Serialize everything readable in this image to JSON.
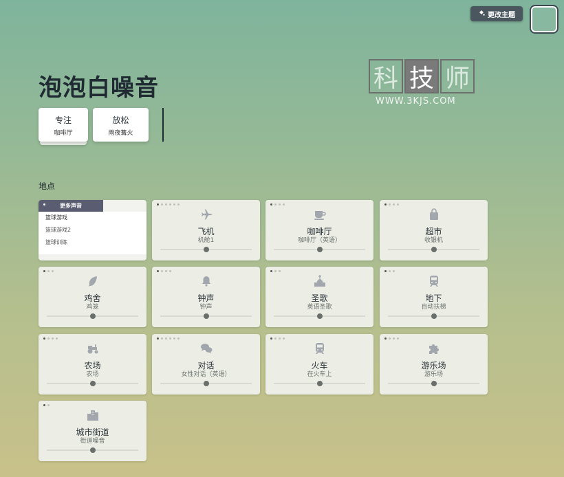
{
  "header": {
    "theme_button_label": "更改主题",
    "app_title": "泡泡白噪音"
  },
  "watermark": {
    "chars": [
      "科",
      "技",
      "师"
    ],
    "url": "WWW.3KJS.COM"
  },
  "modes": [
    {
      "label": "专注",
      "sub": "咖啡厅"
    },
    {
      "label": "放松",
      "sub": "雨夜篝火"
    }
  ],
  "section": {
    "label": "地点"
  },
  "more_sounds": {
    "header": "更多声音",
    "items": [
      "篮球游戏",
      "篮球游戏2",
      "篮球训练"
    ]
  },
  "cards": [
    {
      "name": "飞机",
      "sub": "机舱1",
      "icon": "airplane-icon",
      "dots": 6,
      "level": 0.5
    },
    {
      "name": "咖啡厅",
      "sub": "咖啡厅（英语）",
      "icon": "coffee-cup-icon",
      "dots": 4,
      "level": 0.5
    },
    {
      "name": "超市",
      "sub": "收银机",
      "icon": "shopping-bag-icon",
      "dots": 4,
      "level": 0.5
    },
    {
      "name": "鸡舍",
      "sub": "鸡笼",
      "icon": "feather-icon",
      "dots": 3,
      "level": 0.5
    },
    {
      "name": "钟声",
      "sub": "钟声",
      "icon": "bell-icon",
      "dots": 4,
      "level": 0.5
    },
    {
      "name": "圣歌",
      "sub": "英语圣歌",
      "icon": "church-icon",
      "dots": 3,
      "level": 0.5
    },
    {
      "name": "地下",
      "sub": "自动扶梯",
      "icon": "subway-icon",
      "dots": 3,
      "level": 0.5
    },
    {
      "name": "农场",
      "sub": "农场",
      "icon": "tractor-icon",
      "dots": 4,
      "level": 0.5
    },
    {
      "name": "对话",
      "sub": "女性对话（英语）",
      "icon": "chat-bubbles-icon",
      "dots": 6,
      "level": 0.5
    },
    {
      "name": "火车",
      "sub": "在火车上",
      "icon": "train-icon",
      "dots": 4,
      "level": 0.5
    },
    {
      "name": "游乐场",
      "sub": "游乐场",
      "icon": "puzzle-piece-icon",
      "dots": 4,
      "level": 0.5
    },
    {
      "name": "城市街道",
      "sub": "街道噪音",
      "icon": "city-buildings-icon",
      "dots": 2,
      "level": 0.5
    }
  ],
  "colors": {
    "accent_dark": "#4a575e",
    "more_header": "#5a5d72",
    "icon_gray": "#a2a6ad"
  }
}
